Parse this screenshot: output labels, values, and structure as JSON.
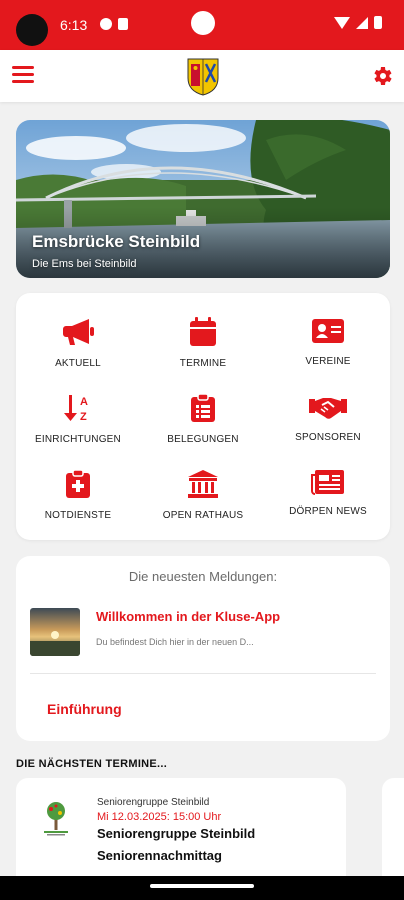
{
  "status_bar": {
    "time": "6:13"
  },
  "header": {
    "menu_icon": "hamburger-icon",
    "settings_icon": "gear-icon",
    "logo": "coat-of-arms"
  },
  "hero": {
    "title": "Emsbrücke Steinbild",
    "subtitle": "Die Ems bei Steinbild"
  },
  "grid": {
    "items": [
      {
        "label": "AKTUELL",
        "icon": "megaphone-icon"
      },
      {
        "label": "TERMINE",
        "icon": "calendar-icon"
      },
      {
        "label": "VEREINE",
        "icon": "id-card-icon"
      },
      {
        "label": "EINRICHTUNGEN",
        "icon": "sort-alpha-icon"
      },
      {
        "label": "BELEGUNGEN",
        "icon": "clipboard-list-icon"
      },
      {
        "label": "SPONSOREN",
        "icon": "handshake-icon"
      },
      {
        "label": "NOTDIENSTE",
        "icon": "medical-kit-icon"
      },
      {
        "label": "OPEN RATHAUS",
        "icon": "town-hall-icon"
      },
      {
        "label": "DÖRPEN NEWS",
        "icon": "newspaper-icon"
      }
    ]
  },
  "news": {
    "heading": "Die neuesten Meldungen:",
    "items": [
      {
        "title": "Willkommen in der Kluse-App",
        "excerpt": "Du befindest Dich hier in der neuen D..."
      }
    ],
    "link_label": "Einführung"
  },
  "events": {
    "heading": "DIE NÄCHSTEN TERMINE...",
    "items": [
      {
        "organizer": "Seniorengruppe Steinbild",
        "date": "Mi 12.03.2025: 15:00 Uhr",
        "title": "Seniorengruppe Steinbild",
        "subtitle": "Seniorennachmittag"
      }
    ]
  },
  "colors": {
    "accent": "#e3181d",
    "background": "#f1f1f1",
    "card": "#ffffff"
  }
}
